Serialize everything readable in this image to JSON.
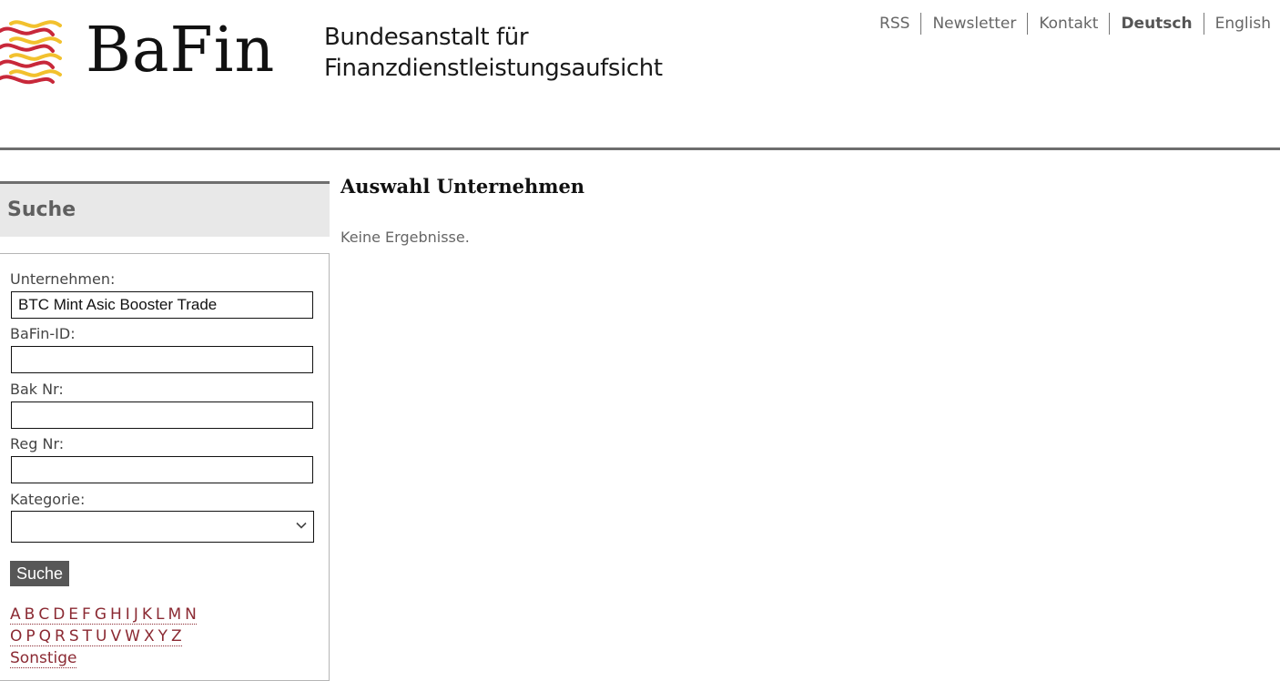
{
  "header": {
    "logo_text": "BaFin",
    "subtitle_line1": "Bundesanstalt für",
    "subtitle_line2": "Finanzdienstleistungsaufsicht",
    "nav": [
      {
        "label": "RSS",
        "active": false
      },
      {
        "label": "Newsletter",
        "active": false
      },
      {
        "label": "Kontakt",
        "active": false
      },
      {
        "label": "Deutsch",
        "active": true
      },
      {
        "label": "English",
        "active": false
      }
    ],
    "brand_colors": {
      "red": "#c8283a",
      "yellow": "#f2c12e"
    }
  },
  "sidebar": {
    "title": "Suche",
    "fields": {
      "company": {
        "label": "Unternehmen:",
        "value": "BTC Mint Asic Booster Trade"
      },
      "bafin_id": {
        "label": "BaFin-ID:",
        "value": ""
      },
      "bak_nr": {
        "label": "Bak Nr:",
        "value": ""
      },
      "reg_nr": {
        "label": "Reg Nr:",
        "value": ""
      },
      "category": {
        "label": "Kategorie:",
        "value": ""
      }
    },
    "search_button": "Suche",
    "alphabet_row1": [
      "A",
      "B",
      "C",
      "D",
      "E",
      "F",
      "G",
      "H",
      "I",
      "J",
      "K",
      "L",
      "M",
      "N"
    ],
    "alphabet_row2": [
      "O",
      "P",
      "Q",
      "R",
      "S",
      "T",
      "U",
      "V",
      "W",
      "X",
      "Y",
      "Z"
    ],
    "other_link": "Sonstige"
  },
  "main": {
    "title": "Auswahl Unternehmen",
    "message": "Keine Ergebnisse."
  }
}
